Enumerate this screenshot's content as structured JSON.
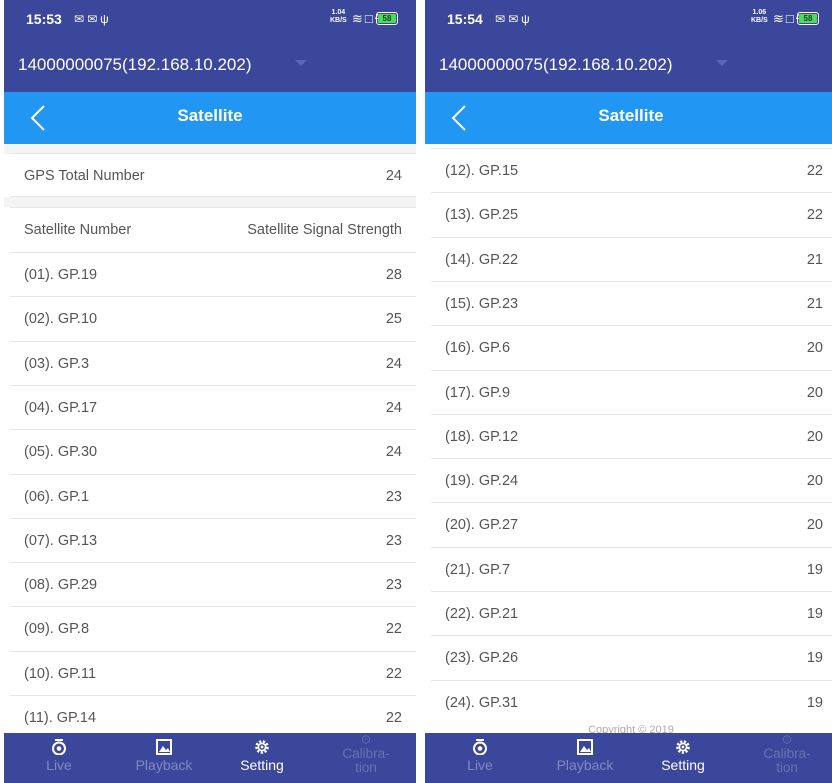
{
  "left": {
    "status": {
      "time": "15:53",
      "speed_top": "1.04",
      "speed_bottom": "KB/S",
      "battery": "58"
    },
    "device": "14000000075(192.168.10.202)",
    "title": "Satellite",
    "gps_total_label": "GPS Total Number",
    "gps_total_value": "24",
    "header_left": "Satellite Number",
    "header_right": "Satellite Signal Strength",
    "rows": [
      {
        "label": "(01). GP.19",
        "value": "28"
      },
      {
        "label": "(02). GP.10",
        "value": "25"
      },
      {
        "label": "(03). GP.3",
        "value": "24"
      },
      {
        "label": "(04). GP.17",
        "value": "24"
      },
      {
        "label": "(05). GP.30",
        "value": "24"
      },
      {
        "label": "(06). GP.1",
        "value": "23"
      },
      {
        "label": "(07). GP.13",
        "value": "23"
      },
      {
        "label": "(08). GP.29",
        "value": "23"
      },
      {
        "label": "(09). GP.8",
        "value": "22"
      },
      {
        "label": "(10). GP.11",
        "value": "22"
      },
      {
        "label": "(11). GP.14",
        "value": "22"
      }
    ],
    "tabs": [
      "Live",
      "Playback",
      "Setting",
      "Calibra-tion"
    ]
  },
  "right": {
    "status": {
      "time": "15:54",
      "speed_top": "1.06",
      "speed_bottom": "KB/S",
      "battery": "58"
    },
    "device": "14000000075(192.168.10.202)",
    "title": "Satellite",
    "rows": [
      {
        "label": "(12). GP.15",
        "value": "22"
      },
      {
        "label": "(13). GP.25",
        "value": "22"
      },
      {
        "label": "(14). GP.22",
        "value": "21"
      },
      {
        "label": "(15). GP.23",
        "value": "21"
      },
      {
        "label": "(16). GP.6",
        "value": "20"
      },
      {
        "label": "(17). GP.9",
        "value": "20"
      },
      {
        "label": "(18). GP.12",
        "value": "20"
      },
      {
        "label": "(19). GP.24",
        "value": "20"
      },
      {
        "label": "(20). GP.27",
        "value": "20"
      },
      {
        "label": "(21). GP.7",
        "value": "19"
      },
      {
        "label": "(22). GP.21",
        "value": "19"
      },
      {
        "label": "(23). GP.26",
        "value": "19"
      },
      {
        "label": "(24). GP.31",
        "value": "19"
      }
    ],
    "copyright": "Copyright © 2019",
    "tabs": [
      "Live",
      "Playback",
      "Setting",
      "Calibra-tion"
    ]
  },
  "icons": {
    "status_left": [
      "message-icon",
      "mail-icon",
      "usb-icon"
    ],
    "status_right": [
      "wifi-icon",
      "screen-icon",
      "charging-icon",
      "battery-icon"
    ],
    "tabs": [
      "camera-icon",
      "image-icon",
      "gear-icon",
      "info-icon"
    ]
  },
  "colors": {
    "header_bg": "#3b479a",
    "title_bg": "#2196f3",
    "tab_active": "#ffffff",
    "tab_inactive": "#7f89c6"
  }
}
